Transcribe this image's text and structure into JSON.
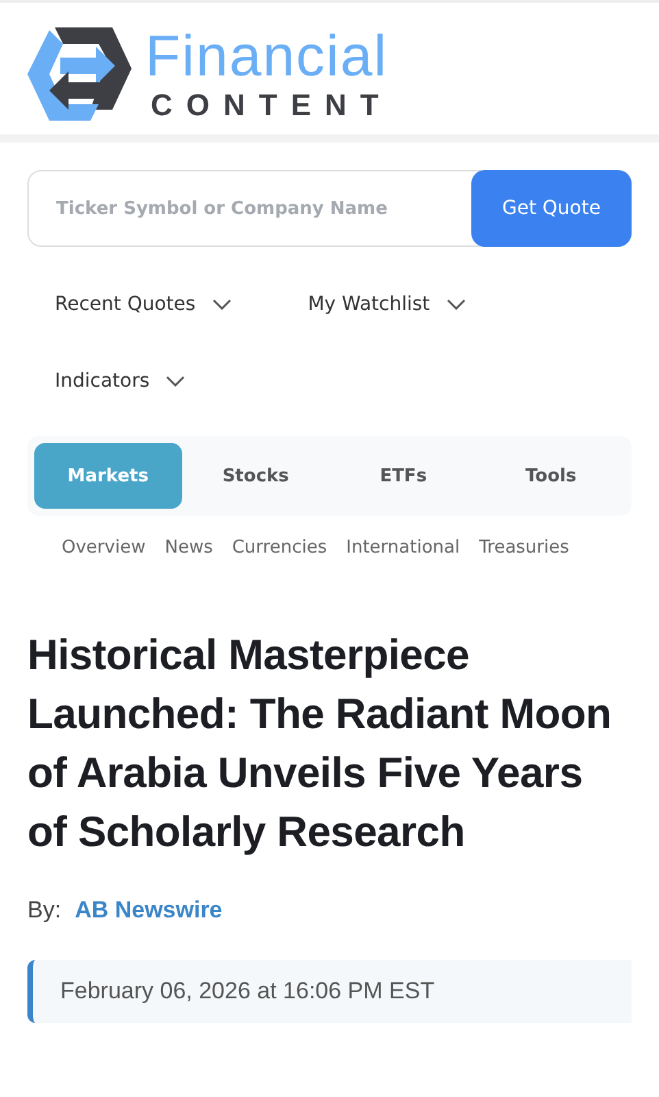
{
  "logo": {
    "line1": "Financial",
    "line2": "CONTENT"
  },
  "search": {
    "placeholder": "Ticker Symbol or Company Name",
    "button": "Get Quote"
  },
  "menus": [
    {
      "label": "Recent Quotes"
    },
    {
      "label": "My Watchlist"
    },
    {
      "label": "Indicators"
    }
  ],
  "tabs": [
    {
      "label": "Markets",
      "selected": true
    },
    {
      "label": "Stocks",
      "selected": false
    },
    {
      "label": "ETFs",
      "selected": false
    },
    {
      "label": "Tools",
      "selected": false
    }
  ],
  "subnav": [
    "Overview",
    "News",
    "Currencies",
    "International",
    "Treasuries"
  ],
  "article": {
    "headline": "Historical Masterpiece Launched: The Radiant Moon of Arabia Unveils Five Years of Scholarly Research",
    "by_label": "By:",
    "author": "AB Newswire",
    "date": "February 06, 2026 at 16:06 PM EST"
  }
}
